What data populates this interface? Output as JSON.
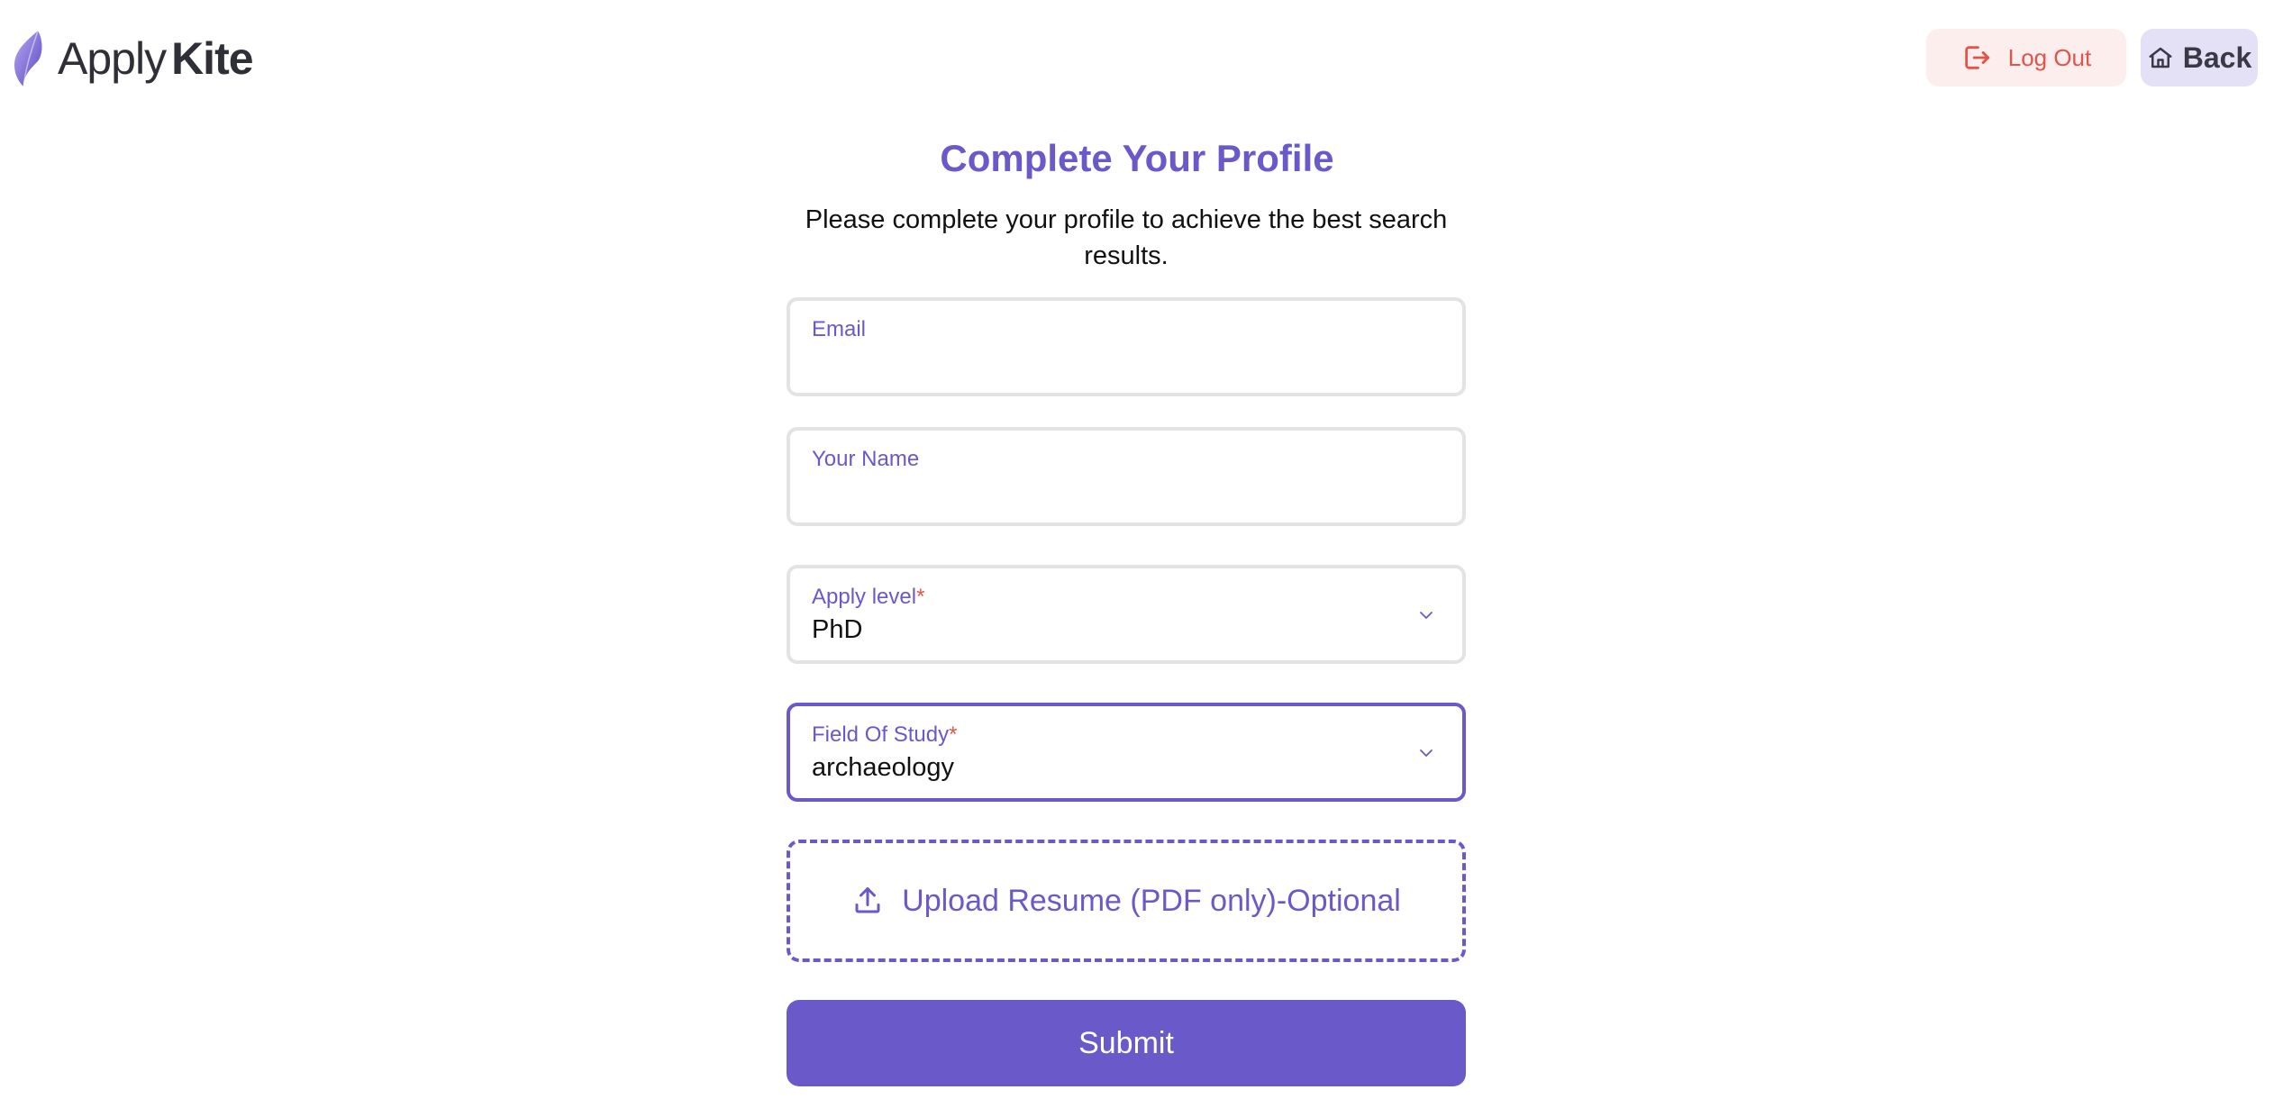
{
  "header": {
    "logo": {
      "word1": "Apply",
      "word2": "Kite",
      "icon": "kite-logo-icon"
    },
    "logout": {
      "label": "Log Out",
      "icon": "log-out-icon"
    },
    "back": {
      "label": "Back",
      "icon": "home-icon"
    }
  },
  "main": {
    "title": "Complete Your Profile",
    "subtitle": "Please complete your profile to achieve the best search results.",
    "fields": {
      "email": {
        "label": "Email",
        "value": ""
      },
      "name": {
        "label": "Your Name",
        "value": ""
      },
      "apply_level": {
        "label": "Apply level",
        "required_mark": "*",
        "value": "PhD",
        "icon": "chevron-down-icon"
      },
      "field_of_study": {
        "label": "Field Of Study",
        "required_mark": "*",
        "value": "archaeology",
        "icon": "chevron-down-icon"
      }
    },
    "upload": {
      "label": "Upload Resume (PDF only)-Optional",
      "icon": "upload-icon"
    },
    "submit": {
      "label": "Submit"
    }
  },
  "colors": {
    "accent": "#6a59c8",
    "danger": "#e0544a",
    "logout_bg": "#fdeeee",
    "back_bg": "#e4e0f6",
    "field_border": "#e3e3e6"
  }
}
